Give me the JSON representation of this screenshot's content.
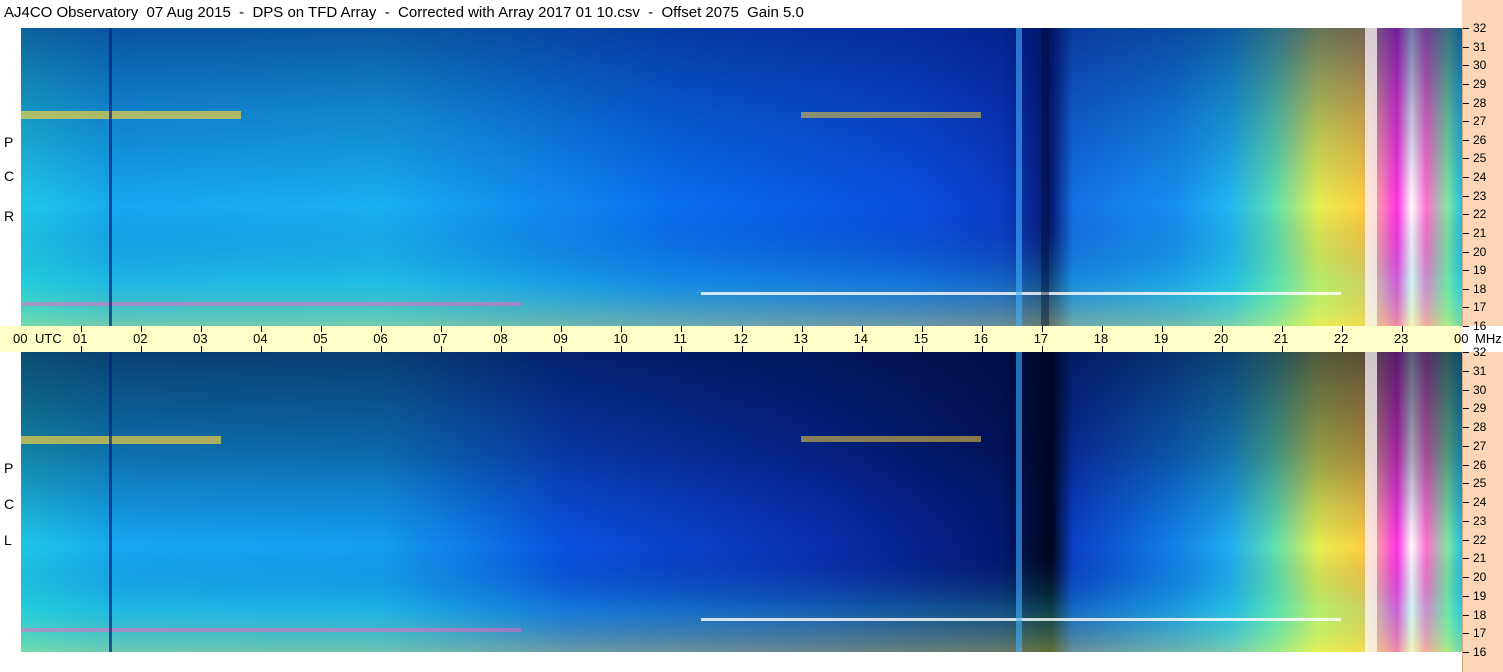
{
  "title": "AJ4CO Observatory  07 Aug 2015  -  DPS on TFD Array  -  Corrected with Array 2017 01 10.csv  -  Offset 2075  Gain 5.0",
  "panels": {
    "top": {
      "polarization_letters": [
        "R",
        "C",
        "P"
      ]
    },
    "bottom": {
      "polarization_letters": [
        "L",
        "C",
        "P"
      ]
    }
  },
  "time_axis": {
    "start_label": "00",
    "unit_label": "UTC",
    "hour_labels": [
      "01",
      "02",
      "03",
      "04",
      "05",
      "06",
      "07",
      "08",
      "09",
      "10",
      "11",
      "12",
      "13",
      "14",
      "15",
      "16",
      "17",
      "18",
      "19",
      "20",
      "21",
      "22",
      "23"
    ],
    "end_label": "00",
    "freq_unit_label": "MHz"
  },
  "freq_axis": {
    "labels": [
      "32",
      "31",
      "30",
      "29",
      "28",
      "27",
      "26",
      "25",
      "24",
      "23",
      "22",
      "21",
      "20",
      "19",
      "18",
      "17",
      "16"
    ],
    "min_mhz": 16,
    "max_mhz": 32
  },
  "colors": {
    "axis_background": "#ffffc8",
    "freq_axis_background": "#fcd5b4",
    "spectrum_low": "#000040",
    "spectrum_mid": "#0050ff",
    "spectrum_high": "#ffff40",
    "spectrum_peak": "#ff00ff"
  }
}
